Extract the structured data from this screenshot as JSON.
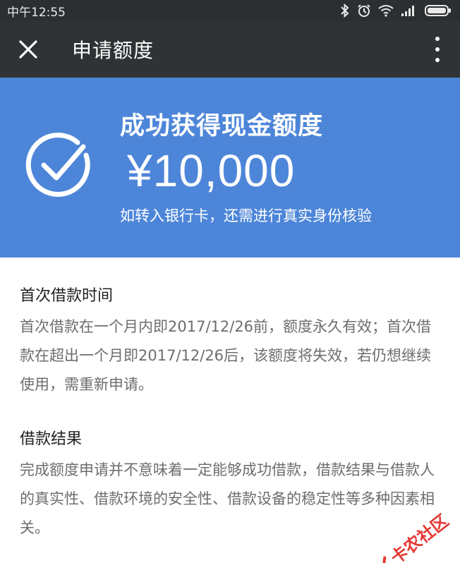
{
  "status_bar": {
    "time": "中午12:55",
    "icons": [
      "bluetooth-icon",
      "alarm-icon",
      "wifi-icon",
      "signal-icon",
      "battery-icon"
    ]
  },
  "app_bar": {
    "title": "申请额度",
    "close_icon": "close-icon",
    "more_icon": "more-vertical-icon"
  },
  "banner": {
    "heading": "成功获得现金额度",
    "amount": "¥10,000",
    "note": "如转入银行卡，还需进行真实身份核验",
    "color": "#4d86d9",
    "icon": "check-circle-icon"
  },
  "sections": [
    {
      "title": "首次借款时间",
      "body": "首次借款在一个月内即2017/12/26前，额度永久有效；首次借款在超出一个月即2017/12/26后，该额度将失效，若仍想继续使用，需重新申请。"
    },
    {
      "title": "借款结果",
      "body": "完成额度申请并不意味着一定能够成功借款，借款结果与借款人的真实性、借款环境的安全性、借款设备的稳定性等多种因素相关。"
    }
  ],
  "watermark": {
    "text": "卡农社区",
    "color": "#e53935"
  }
}
